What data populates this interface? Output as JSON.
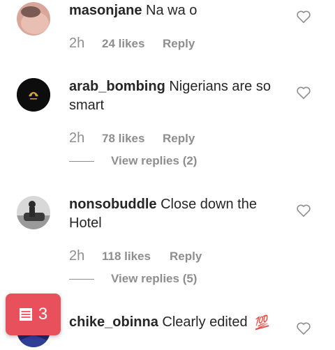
{
  "comments": [
    {
      "username": "masonjane",
      "text": "Na wa o",
      "time": "2h",
      "likes": "24 likes",
      "reply": "Reply"
    },
    {
      "username": "arab_bombing",
      "text": "Nigerians are so smart",
      "time": "2h",
      "likes": "78 likes",
      "reply": "Reply",
      "view_replies": "View replies (2)"
    },
    {
      "username": "nonsobuddle",
      "text": "Close down the Hotel",
      "time": "2h",
      "likes": "118 likes",
      "reply": "Reply",
      "view_replies": "View replies (5)"
    },
    {
      "username": "chike_obinna",
      "text": "Clearly edited",
      "emoji": "💯"
    }
  ],
  "badge": {
    "count": "3",
    "icon": "book-icon",
    "color": "#e8505b"
  },
  "colors": {
    "text": "#262626",
    "muted": "#8e8e8e"
  }
}
